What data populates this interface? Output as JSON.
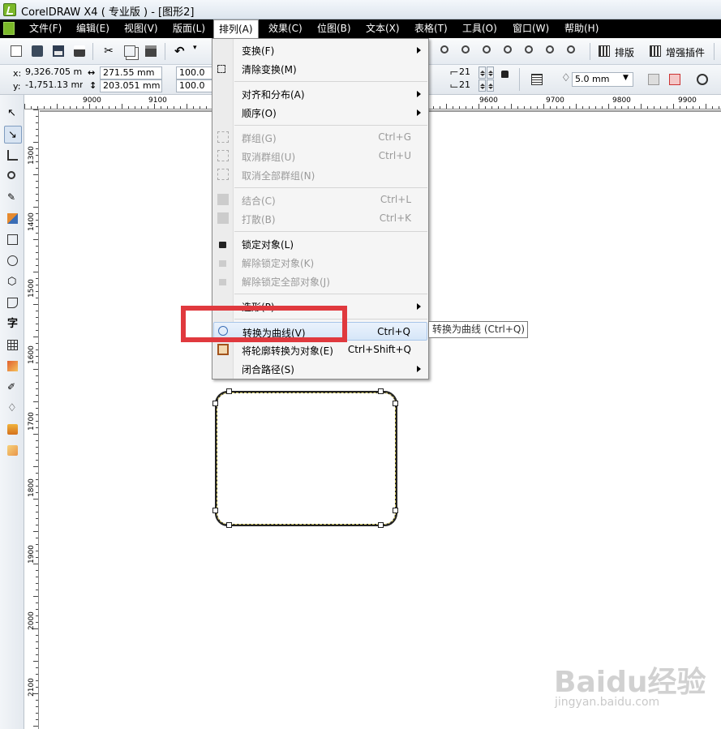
{
  "window": {
    "title": "CorelDRAW X4 ( 专业版 ) - [图形2]"
  },
  "menubar": [
    {
      "label": "文件(F)"
    },
    {
      "label": "编辑(E)"
    },
    {
      "label": "视图(V)"
    },
    {
      "label": "版面(L)"
    },
    {
      "label": "排列(A)",
      "active": true
    },
    {
      "label": "效果(C)"
    },
    {
      "label": "位图(B)"
    },
    {
      "label": "文本(X)"
    },
    {
      "label": "表格(T)"
    },
    {
      "label": "工具(O)"
    },
    {
      "label": "窗口(W)"
    },
    {
      "label": "帮助(H)"
    }
  ],
  "toolbar": {
    "layout_label": "排版",
    "plugin_label": "增强插件"
  },
  "properties": {
    "x_label": "x:",
    "x_value": "9,326.705 mm",
    "y_label": "y:",
    "y_value": "-1,751.13 mm",
    "width_value": "271.55 mm",
    "height_value": "203.051 mm",
    "scale_x": "100.0",
    "scale_y": "100.0",
    "corner_top": "21",
    "corner_bottom": "21",
    "outline_width": "5.0 mm"
  },
  "ruler": {
    "h_labels": [
      "9000",
      "9100",
      "9600",
      "9700",
      "9800",
      "9900"
    ],
    "v_labels": [
      "1300",
      "1400",
      "1500",
      "1600",
      "1700",
      "1800",
      "1900",
      "2000",
      "2100"
    ]
  },
  "arrange_menu": {
    "items": [
      {
        "label": "变换(F)",
        "submenu": true,
        "enabled": true
      },
      {
        "label": "清除变换(M)",
        "enabled": true
      },
      {
        "label": "对齐和分布(A)",
        "submenu": true,
        "enabled": true
      },
      {
        "label": "顺序(O)",
        "submenu": true,
        "enabled": true
      },
      {
        "label": "群组(G)",
        "shortcut": "Ctrl+G",
        "enabled": false
      },
      {
        "label": "取消群组(U)",
        "shortcut": "Ctrl+U",
        "enabled": false
      },
      {
        "label": "取消全部群组(N)",
        "enabled": false
      },
      {
        "label": "结合(C)",
        "shortcut": "Ctrl+L",
        "enabled": false
      },
      {
        "label": "打散(B)",
        "shortcut": "Ctrl+K",
        "enabled": false
      },
      {
        "label": "锁定对象(L)",
        "enabled": true
      },
      {
        "label": "解除锁定对象(K)",
        "enabled": false
      },
      {
        "label": "解除锁定全部对象(J)",
        "enabled": false
      },
      {
        "label": "造形(P)",
        "submenu": true,
        "enabled": true
      },
      {
        "label": "转换为曲线(V)",
        "shortcut": "Ctrl+Q",
        "enabled": true,
        "highlighted": true
      },
      {
        "label": "将轮廓转换为对象(E)",
        "shortcut": "Ctrl+Shift+Q",
        "enabled": true
      },
      {
        "label": "闭合路径(S)",
        "submenu": true,
        "enabled": true
      }
    ]
  },
  "tooltip": {
    "text": "转换为曲线 (Ctrl+Q)"
  },
  "watermark": {
    "text": "Baidu经验",
    "sub": "jingyan.baidu.com"
  },
  "colors": {
    "highlight_box": "#e0393e",
    "menubar_bg": "#000000",
    "shape_dash": "#e2d56b"
  }
}
